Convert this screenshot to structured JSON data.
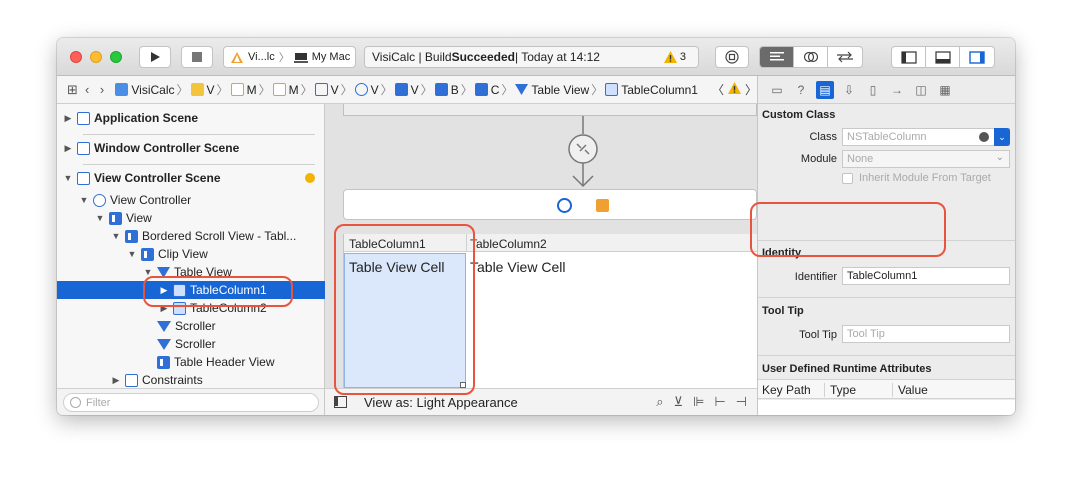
{
  "toolbar": {
    "scheme_target": "Vi...lc",
    "scheme_device": "My Mac",
    "activity_prefix": "VisiCalc | Build ",
    "activity_status": "Succeeded",
    "activity_time": " | Today at 14:12",
    "warning_count": "3"
  },
  "pathbar": {
    "items": [
      "VisiCalc",
      "V",
      "M",
      "M",
      "V",
      "V",
      "V",
      "B",
      "C",
      "Table View",
      "TableColumn1"
    ]
  },
  "navigator": {
    "scenes": [
      {
        "label": "Application Scene"
      },
      {
        "label": "Window Controller Scene"
      },
      {
        "label": "View Controller Scene"
      }
    ],
    "tree": [
      {
        "label": "View Controller"
      },
      {
        "label": "View"
      },
      {
        "label": "Bordered Scroll View - Tabl..."
      },
      {
        "label": "Clip View"
      },
      {
        "label": "Table View"
      },
      {
        "label": "TableColumn1"
      },
      {
        "label": "TableColumn2"
      },
      {
        "label": "Scroller"
      },
      {
        "label": "Scroller"
      },
      {
        "label": "Table Header View"
      },
      {
        "label": "Constraints"
      }
    ],
    "filter_placeholder": "Filter"
  },
  "canvas": {
    "col1_header": "TableColumn1",
    "col2_header": "TableColumn2",
    "cell1": "Table View Cell",
    "cell2": "Table View Cell",
    "view_as": "View as: Light Appearance"
  },
  "inspector": {
    "custom_class_title": "Custom Class",
    "class_label": "Class",
    "class_placeholder": "NSTableColumn",
    "module_label": "Module",
    "module_placeholder": "None",
    "inherit_label": "Inherit Module From Target",
    "identity_title": "Identity",
    "identifier_label": "Identifier",
    "identifier_value": "TableColumn1",
    "tooltip_title": "Tool Tip",
    "tooltip_label": "Tool Tip",
    "tooltip_placeholder": "Tool Tip",
    "udra_title": "User Defined Runtime Attributes",
    "udra_columns": [
      "Key Path",
      "Type",
      "Value"
    ]
  },
  "colors": {
    "accent": "#1866d6",
    "highlight": "#e8553e",
    "warning": "#f1b400"
  }
}
